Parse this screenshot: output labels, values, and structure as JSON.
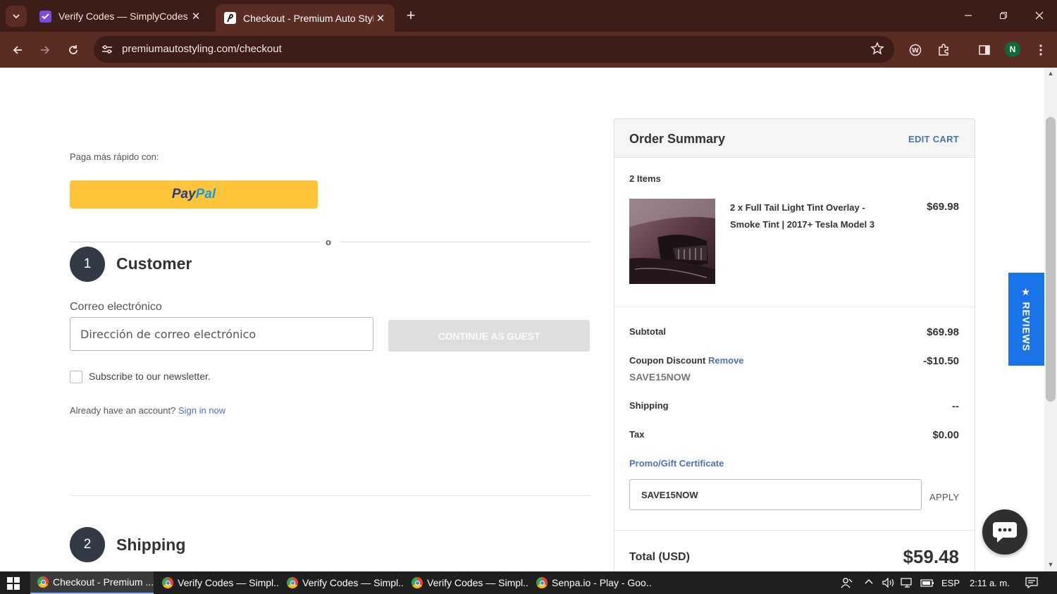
{
  "browser": {
    "tabs": [
      {
        "title": "Verify Codes — SimplyCodes",
        "favicon": "simplycodes-icon",
        "active": false
      },
      {
        "title": "Checkout - Premium Auto Styling",
        "favicon": "premium-auto-styling-icon",
        "active": true
      }
    ],
    "url": "premiumautostyling.com/checkout",
    "profile_initial": "N"
  },
  "page": {
    "paga_label": "Paga más rápido con:",
    "paypal": {
      "pay": "Pay",
      "pal": "Pal"
    },
    "or_text": "o",
    "customer": {
      "step": "1",
      "title": "Customer",
      "email_label": "Correo electrónico",
      "email_placeholder": "Dirección de correo electrónico",
      "guest_button": "CONTINUE AS GUEST",
      "newsletter_label": "Subscribe to our newsletter.",
      "account_prompt": "Already have an account?",
      "sign_in": "Sign in now"
    },
    "shipping": {
      "step": "2",
      "title": "Shipping"
    }
  },
  "summary": {
    "title": "Order Summary",
    "edit_cart": "EDIT CART",
    "items_count": "2 Items",
    "product": {
      "name": "2 x Full Tail Light Tint Overlay - Smoke Tint | 2017+ Tesla Model 3",
      "price": "$69.98"
    },
    "subtotal_label": "Subtotal",
    "subtotal_value": "$69.98",
    "coupon_label": "Coupon Discount",
    "coupon_remove": "Remove",
    "coupon_value": "-$10.50",
    "coupon_code": "SAVE15NOW",
    "shipping_label": "Shipping",
    "shipping_value": "--",
    "tax_label": "Tax",
    "tax_value": "$0.00",
    "promo_link": "Promo/Gift Certificate",
    "promo_input_value": "SAVE15NOW",
    "apply": "APPLY",
    "total_label": "Total (USD)",
    "total_value": "$59.48"
  },
  "widgets": {
    "reviews_tab": "★ REVIEWS"
  },
  "taskbar": {
    "items": [
      {
        "label": "Checkout - Premium ...",
        "active": true
      },
      {
        "label": "Verify Codes — Simpl...",
        "active": false
      },
      {
        "label": "Verify Codes — Simpl...",
        "active": false
      },
      {
        "label": "Verify Codes — Simpl...",
        "active": false
      },
      {
        "label": "Senpa.io - Play - Goo...",
        "active": false
      }
    ],
    "language": "ESP",
    "time": "2:11 a. m."
  },
  "colors": {
    "chrome_dark": "#3c1d18",
    "chrome_toolbar": "#5a2c24",
    "link_blue": "#4a73b3",
    "paypal_yellow": "#ffc439",
    "reviews_blue": "#1a74e8",
    "step_circle": "#323a46"
  }
}
